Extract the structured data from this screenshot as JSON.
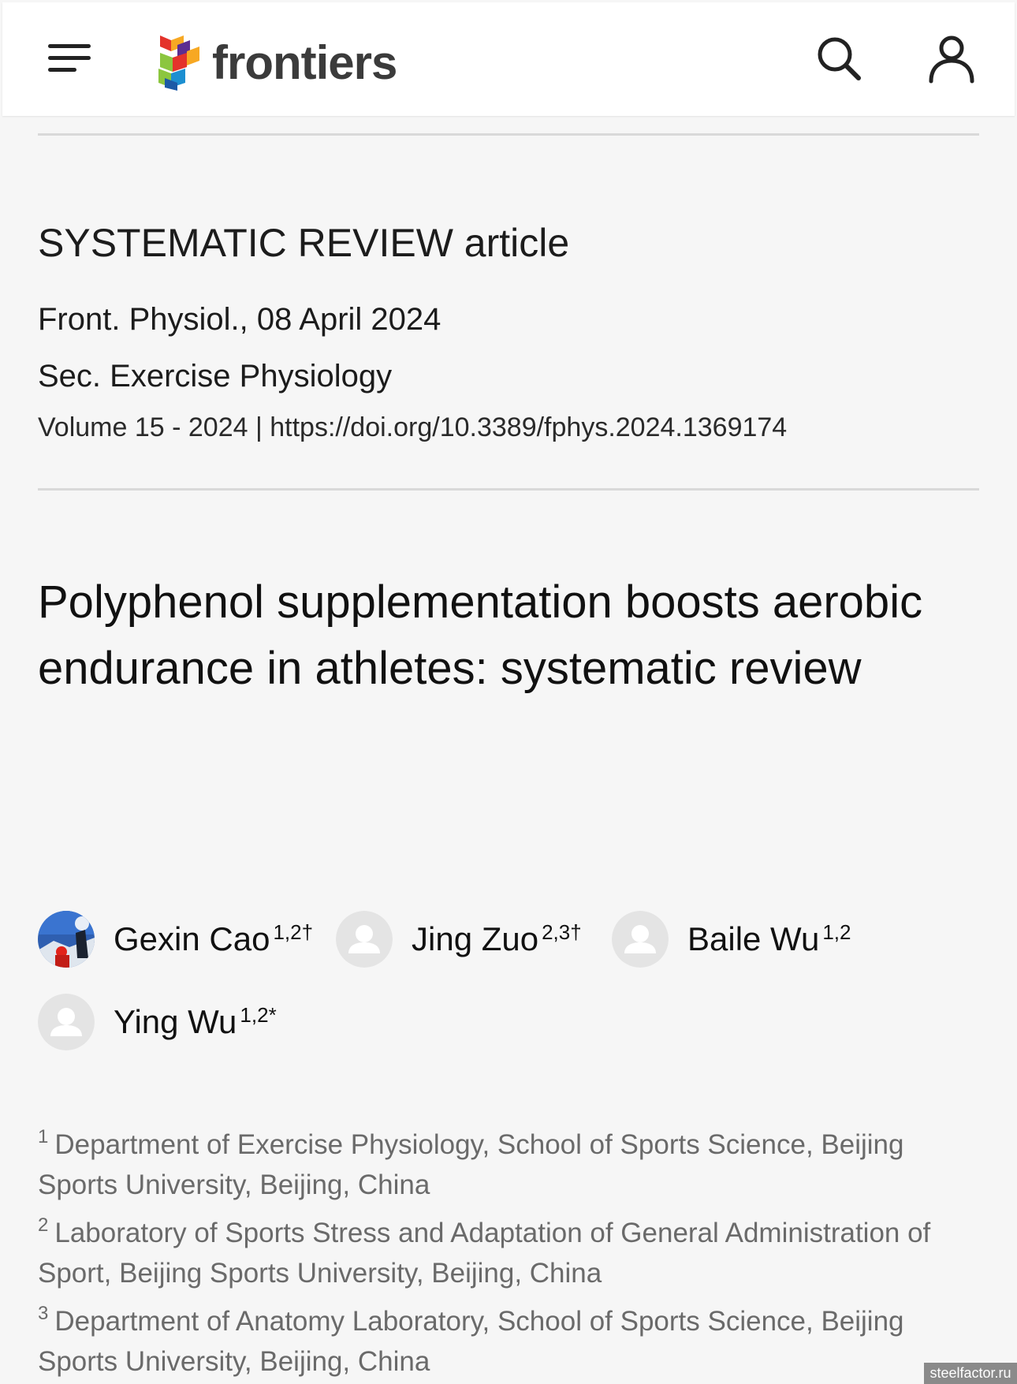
{
  "header": {
    "logo_text": "frontiers",
    "menu_icon": "hamburger-menu-icon",
    "search_icon": "search-icon",
    "user_icon": "user-account-icon"
  },
  "article": {
    "type": "SYSTEMATIC REVIEW article",
    "journal_date": "Front. Physiol., 08 April 2024",
    "section": "Sec. Exercise Physiology",
    "volume": "Volume 15 - 2024 | ",
    "doi": "https://doi.org/10.3389/fphys.2024.1369174",
    "title": "Polyphenol supplementation boosts aerobic endurance in athletes: systematic review"
  },
  "authors": [
    {
      "name": "Gexin Cao",
      "sup": "1,2†"
    },
    {
      "name": "Jing Zuo",
      "sup": "2,3†"
    },
    {
      "name": "Baile Wu",
      "sup": "1,2"
    },
    {
      "name": "Ying Wu",
      "sup": "1,2*"
    }
  ],
  "affiliations": [
    {
      "num": "1",
      "text": "Department of Exercise Physiology, School of Sports Science, Beijing Sports University, Beijing, China"
    },
    {
      "num": "2",
      "text": "Laboratory of Sports Stress and Adaptation of General Administration of Sport, Beijing Sports University, Beijing, China"
    },
    {
      "num": "3",
      "text": "Department of Anatomy Laboratory, School of Sports Science, Beijing Sports University, Beijing, China"
    }
  ],
  "watermark": "steelfactor.ru",
  "colors": {
    "background": "#f6f6f6",
    "header": "#ffffff",
    "rule": "#d9d9d9",
    "affiliation_text": "#6a6a6a"
  }
}
